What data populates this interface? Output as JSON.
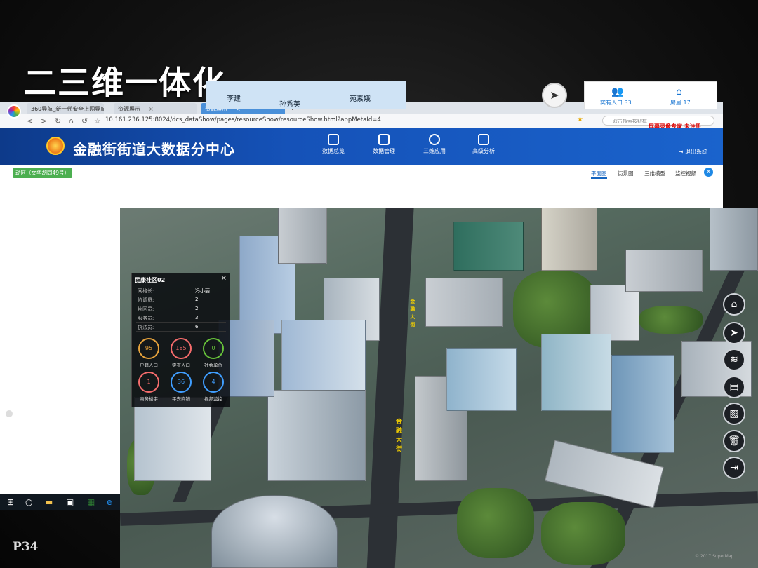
{
  "slide": {
    "title": "二三维一体化",
    "page_number": "P34"
  },
  "browser": {
    "tabs": [
      {
        "label": "360导航_新一代安全上网导航"
      },
      {
        "label": "资源展示"
      },
      {
        "label": "资源展示",
        "active": true
      }
    ],
    "url": "10.161.236.125:8024/dcs_dataShow/pages/resourceShow/resourceShow.html?appMetaId=4",
    "url_host": "10.161.236.125",
    "search_placeholder": "双击搜索按钮框",
    "watermark": "屏幕录像专家 未注册"
  },
  "app": {
    "title": "金融街街道大数据分中心",
    "nav": [
      "数据总览",
      "数据管理",
      "三维应用",
      "高级分析"
    ],
    "logout": "退出系统",
    "location_badge": "动区（文华胡同49号）",
    "view_tabs": [
      "平面图",
      "街景图",
      "三维模型",
      "监控视频"
    ],
    "pillar_labels": [
      "李建",
      "孙秀英",
      "苑素娥"
    ],
    "right_cards": [
      {
        "label": "实有人口 33"
      },
      {
        "label": "房屋 17"
      }
    ]
  },
  "map": {
    "road_label": "金融大街",
    "road_label_2": "金融大街",
    "copyright": "© 2017 SuperMap"
  },
  "popup": {
    "title": "民康社区02",
    "rows": [
      {
        "k": "网格长:",
        "v": "冯小丽"
      },
      {
        "k": "协调员:",
        "v": "2"
      },
      {
        "k": "片区员:",
        "v": "2"
      },
      {
        "k": "服务员:",
        "v": "3"
      },
      {
        "k": "执法员:",
        "v": "6"
      }
    ],
    "stats": [
      {
        "value": "95",
        "label": "户籍人口",
        "color": "#e6a23c"
      },
      {
        "value": "185",
        "label": "实有人口",
        "color": "#f56c6c"
      },
      {
        "value": "0",
        "label": "社会单位",
        "color": "#67c23a"
      },
      {
        "value": "1",
        "label": "商务楼宇",
        "color": "#f56c6c"
      },
      {
        "value": "36",
        "label": "平安商铺",
        "color": "#409eff"
      },
      {
        "value": "4",
        "label": "视频监控",
        "color": "#409eff"
      }
    ]
  },
  "toolbar": [
    "home-icon",
    "locate-icon",
    "layers-icon",
    "keyboard-icon",
    "measure-icon",
    "trash-icon",
    "exit-icon"
  ]
}
